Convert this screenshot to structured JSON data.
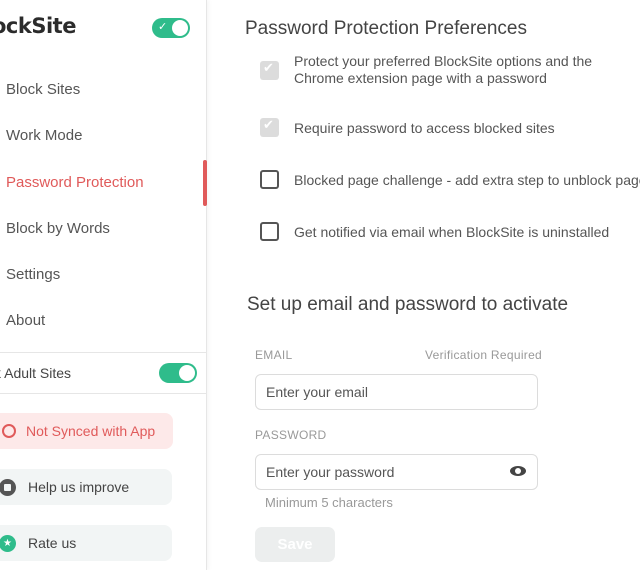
{
  "sidebar": {
    "logo": "ockSite",
    "main_toggle_on": true,
    "items": [
      {
        "label": "Block Sites"
      },
      {
        "label": "Work Mode"
      },
      {
        "label": "Password Protection",
        "active": true
      },
      {
        "label": "Block by Words"
      },
      {
        "label": "Settings"
      },
      {
        "label": "About"
      }
    ],
    "adult_sites_label": "k Adult Sites",
    "adult_toggle_on": true,
    "sync_label": "Not Synced with App",
    "help_label": "Help us improve",
    "rate_label": "Rate us"
  },
  "preferences": {
    "title": "Password Protection Preferences",
    "options": [
      {
        "label": "Protect your preferred BlockSite options and the Chrome extension page with a password",
        "checked": true
      },
      {
        "label": "Require password to access blocked sites",
        "checked": true
      },
      {
        "label": "Blocked page challenge - add extra step to unblock page",
        "checked": false
      },
      {
        "label": "Get notified via email when BlockSite is uninstalled",
        "checked": false
      }
    ]
  },
  "setup": {
    "title": "Set up email and password to activate",
    "email_label": "EMAIL",
    "verification_note": "Verification Required",
    "email_placeholder": "Enter your email",
    "password_label": "PASSWORD",
    "password_placeholder": "Enter your password",
    "password_hint": "Minimum 5 characters",
    "save_label": "Save"
  },
  "colors": {
    "accent_green": "#2fbc8b",
    "accent_red": "#e05a5a"
  }
}
